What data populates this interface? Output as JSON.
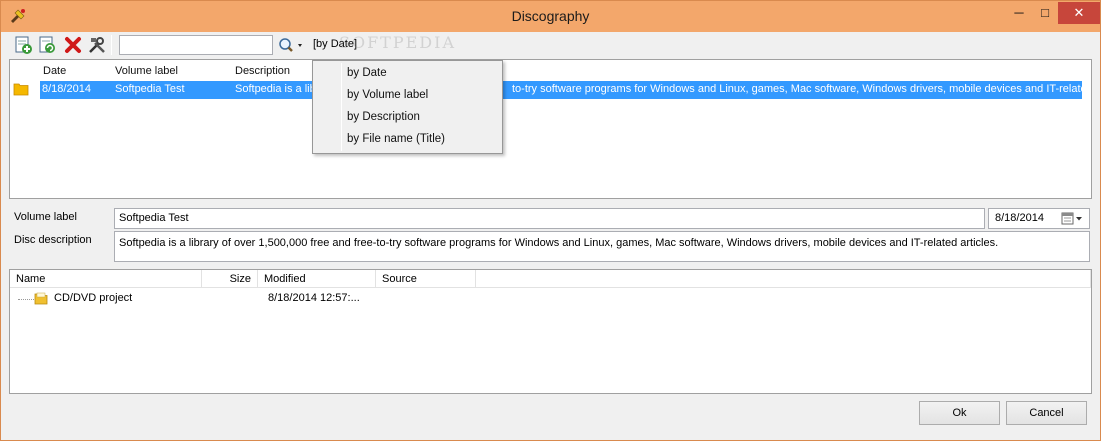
{
  "window": {
    "title": "Discography"
  },
  "titlebar_buttons": {
    "minimize": "─",
    "maximize": "□",
    "close": "✕"
  },
  "toolbar": {
    "icons": [
      "add-disc-icon",
      "refresh-disc-icon",
      "delete-icon",
      "tools-icon"
    ],
    "search_value": "",
    "search_icon": "magnifier-icon",
    "sort_label": "[by Date]",
    "watermark": "SOFTPEDIA"
  },
  "disc_list": {
    "columns": [
      "Date",
      "Volume label",
      "Description"
    ],
    "rows": [
      {
        "date": "8/18/2014",
        "volume_label": "Softpedia Test",
        "description_head": "Softpedia is a libr",
        "description_tail": "to-try software programs for Windows and Linux, games, Mac software, Windows drivers, mobile devices and IT-related a"
      }
    ]
  },
  "details": {
    "volume_label_caption": "Volume label",
    "volume_label_value": "Softpedia Test",
    "date_value": "8/18/2014",
    "disc_description_caption": "Disc description",
    "disc_description_value": "Softpedia is a library of over 1,500,000 free and free-to-try software programs for Windows and Linux, games, Mac software, Windows drivers, mobile devices and IT-related articles."
  },
  "files": {
    "columns": [
      "Name",
      "Size",
      "Modified",
      "Source"
    ],
    "rows": [
      {
        "name": "CD/DVD project",
        "size": "",
        "modified": "8/18/2014 12:57:...",
        "source": ""
      }
    ]
  },
  "buttons": {
    "ok": "Ok",
    "cancel": "Cancel"
  },
  "sort_menu": {
    "items": [
      "by Date",
      "by Volume label",
      "by Description",
      "by File name (Title)"
    ]
  },
  "colors": {
    "titlebar": "#f3a76b",
    "selection": "#3399ff",
    "close_button": "#c7463b"
  }
}
